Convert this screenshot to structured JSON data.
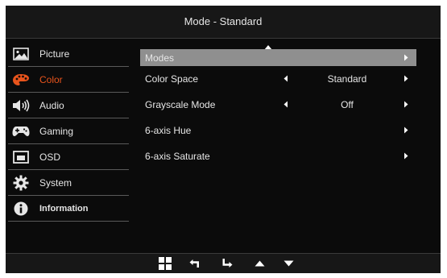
{
  "title": "Mode - Standard",
  "sidebar": {
    "items": [
      {
        "label": "Picture",
        "icon": "picture-icon"
      },
      {
        "label": "Color",
        "icon": "palette-icon"
      },
      {
        "label": "Audio",
        "icon": "speaker-icon"
      },
      {
        "label": "Gaming",
        "icon": "gamepad-icon"
      },
      {
        "label": "OSD",
        "icon": "osd-icon"
      },
      {
        "label": "System",
        "icon": "gear-icon"
      },
      {
        "label": "Information",
        "icon": "info-icon"
      }
    ]
  },
  "menu": {
    "rows": [
      {
        "label": "Modes",
        "value": ""
      },
      {
        "label": "Color Space",
        "value": "Standard"
      },
      {
        "label": "Grayscale Mode",
        "value": "Off"
      },
      {
        "label": "6-axis Hue",
        "value": ""
      },
      {
        "label": "6-axis Saturate",
        "value": ""
      }
    ]
  },
  "bottom_bar": {
    "icons": [
      "menu-grid-icon",
      "back-icon",
      "enter-icon",
      "up-icon",
      "down-icon"
    ]
  },
  "colors": {
    "accent": "#e8541c",
    "highlight": "#8f8f8f",
    "background": "#0b0b0b"
  }
}
